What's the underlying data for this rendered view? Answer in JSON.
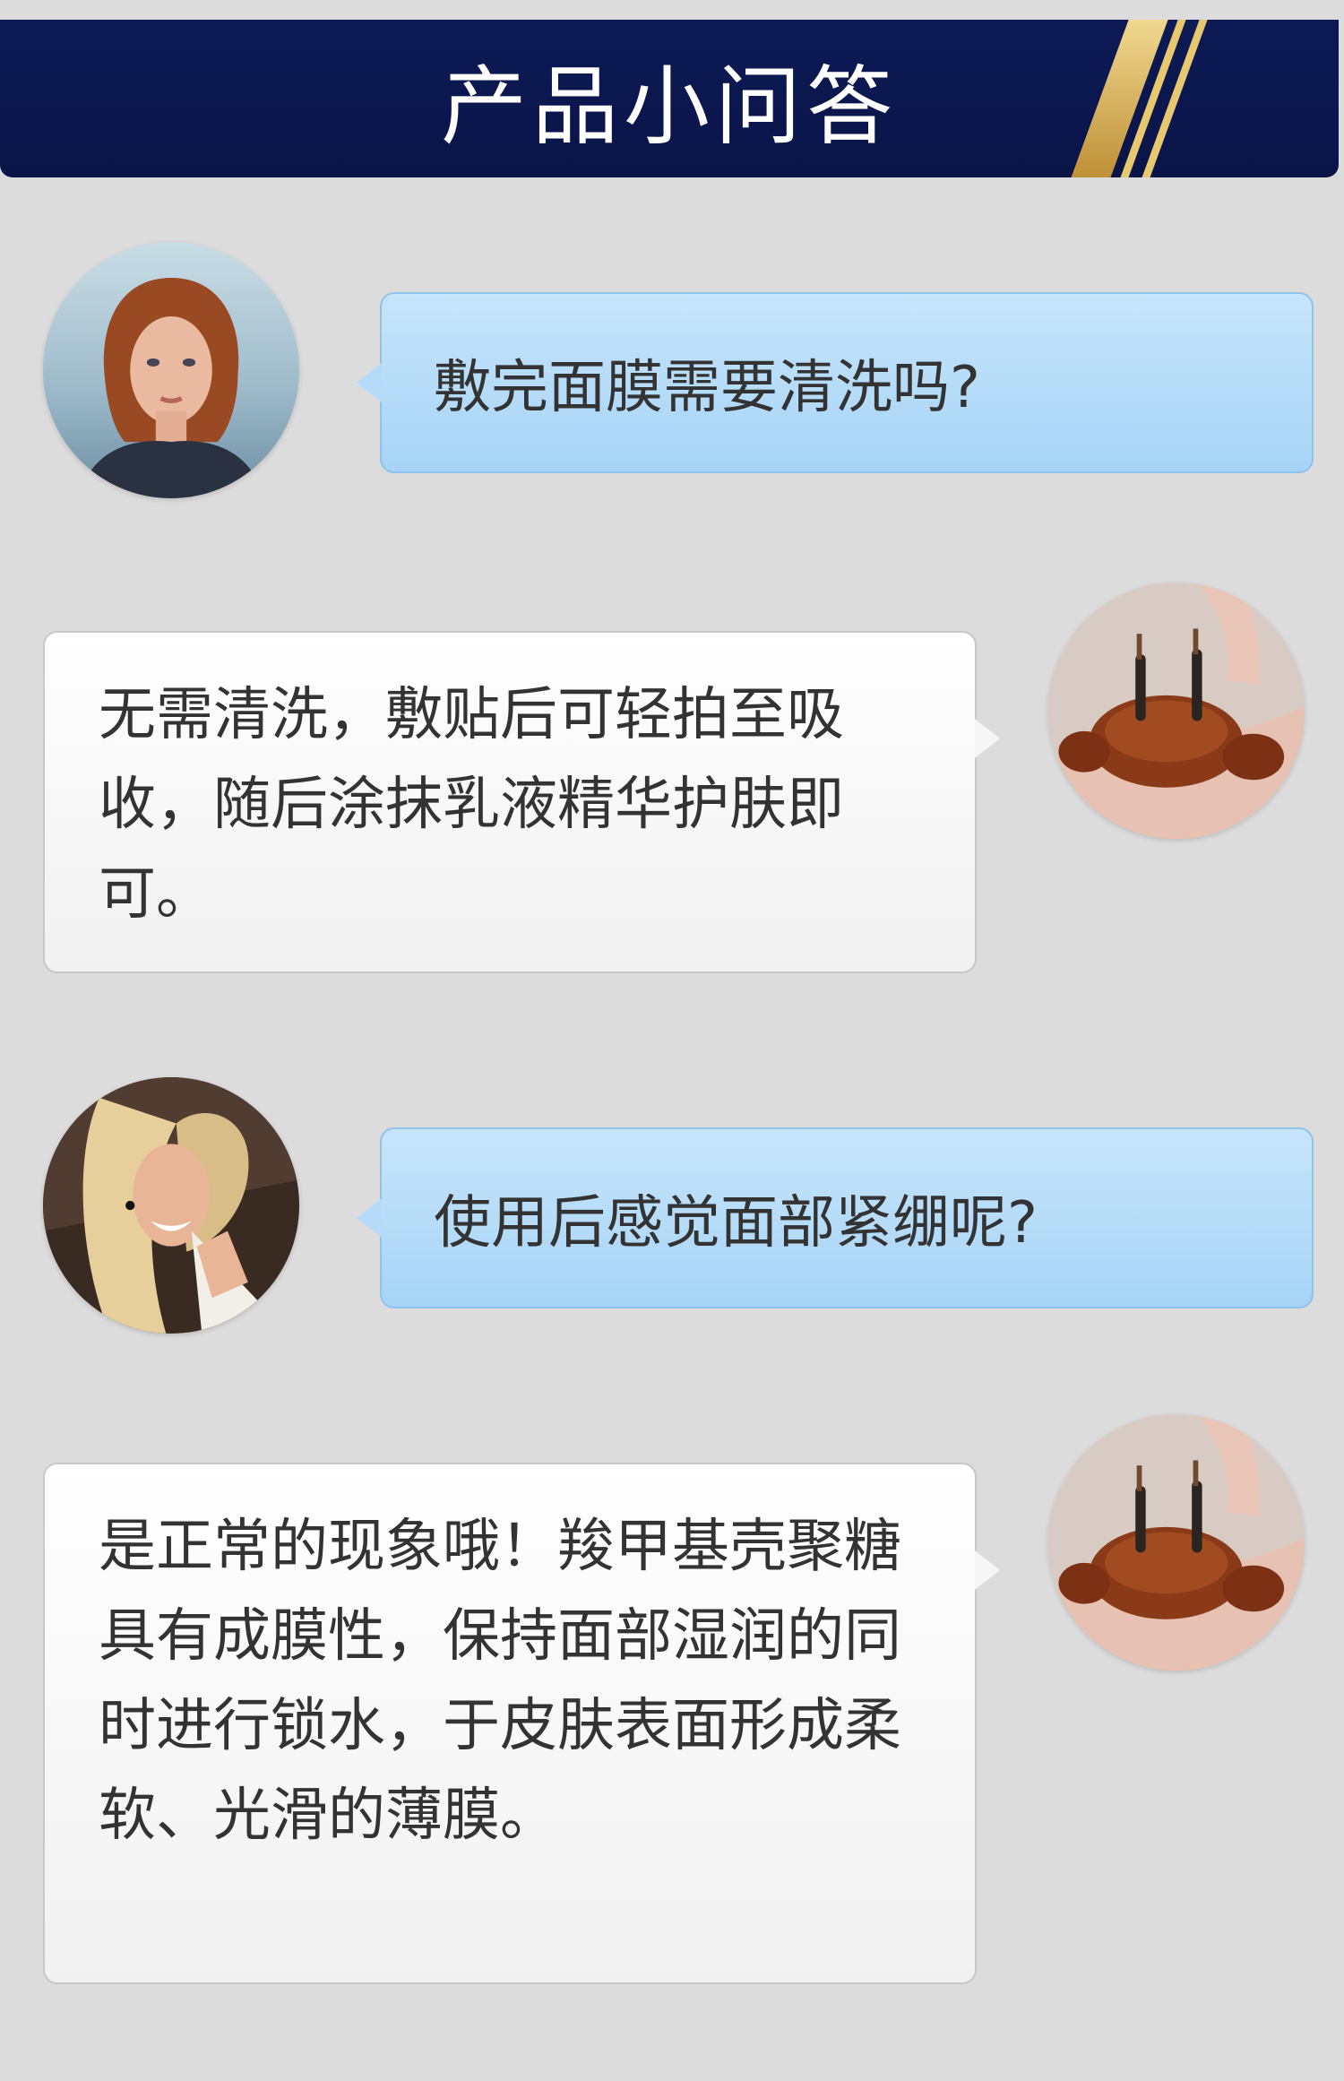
{
  "header": {
    "title": "产品小问答"
  },
  "conversation": [
    {
      "role": "question",
      "avatar": "woman-redhead-avatar",
      "text": "敷完面膜需要清洗吗?"
    },
    {
      "role": "answer",
      "avatar": "crab-avatar",
      "text": "无需清洗，敷贴后可轻拍至吸收，随后涂抹乳液精华护肤即可。"
    },
    {
      "role": "question",
      "avatar": "woman-blonde-avatar",
      "text": "使用后感觉面部紧绷呢?"
    },
    {
      "role": "answer",
      "avatar": "crab-avatar",
      "text": "是正常的现象哦！羧甲基壳聚糖具有成膜性，保持面部湿润的同时进行锁水，于皮肤表面形成柔软、光滑的薄膜。"
    }
  ],
  "colors": {
    "header_bg": "#0d1a55",
    "gold": "#e7c86e",
    "question_bubble": "#b5dbf8",
    "answer_bubble": "#f6f6f6",
    "page_bg": "#dcdcdc"
  }
}
